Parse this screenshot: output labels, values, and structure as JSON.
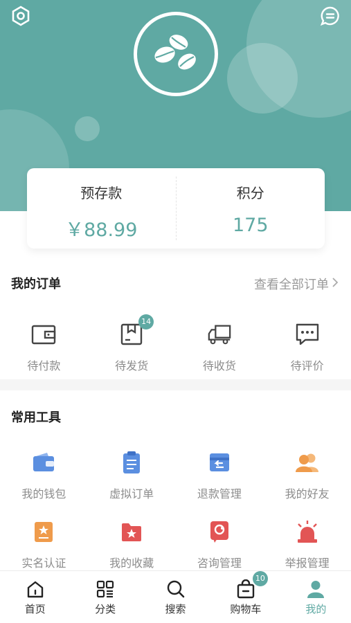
{
  "header": {
    "settings_icon": "settings-icon",
    "message_icon": "message-icon",
    "logo_icon": "coffee-beans-icon"
  },
  "balance": {
    "deposit_label": "预存款",
    "deposit_value": "￥88.99",
    "points_label": "积分",
    "points_value": "175"
  },
  "orders": {
    "title": "我的订单",
    "view_all": "查看全部订单",
    "items": [
      {
        "label": "待付款",
        "icon": "wallet-icon"
      },
      {
        "label": "待发货",
        "icon": "package-icon",
        "badge": "14"
      },
      {
        "label": "待收货",
        "icon": "truck-icon"
      },
      {
        "label": "待评价",
        "icon": "comment-icon"
      }
    ]
  },
  "tools": {
    "title": "常用工具",
    "items": [
      {
        "label": "我的钱包",
        "icon": "wallet-icon"
      },
      {
        "label": "虚拟订单",
        "icon": "clipboard-icon"
      },
      {
        "label": "退款管理",
        "icon": "refund-icon"
      },
      {
        "label": "我的好友",
        "icon": "friends-icon"
      },
      {
        "label": "实名认证",
        "icon": "id-card-icon"
      },
      {
        "label": "我的收藏",
        "icon": "favorite-folder-icon"
      },
      {
        "label": "咨询管理",
        "icon": "consult-icon"
      },
      {
        "label": "举报管理",
        "icon": "alarm-icon"
      }
    ]
  },
  "tabbar": {
    "items": [
      {
        "label": "首页",
        "icon": "home-icon"
      },
      {
        "label": "分类",
        "icon": "category-icon"
      },
      {
        "label": "搜索",
        "icon": "search-icon"
      },
      {
        "label": "购物车",
        "icon": "cart-icon",
        "badge": "10"
      },
      {
        "label": "我的",
        "icon": "user-icon",
        "active": true
      }
    ]
  },
  "colors": {
    "accent": "#5fa9a3",
    "blue": "#5b8fe0",
    "orange": "#ef9b4b",
    "red": "#e25555"
  }
}
